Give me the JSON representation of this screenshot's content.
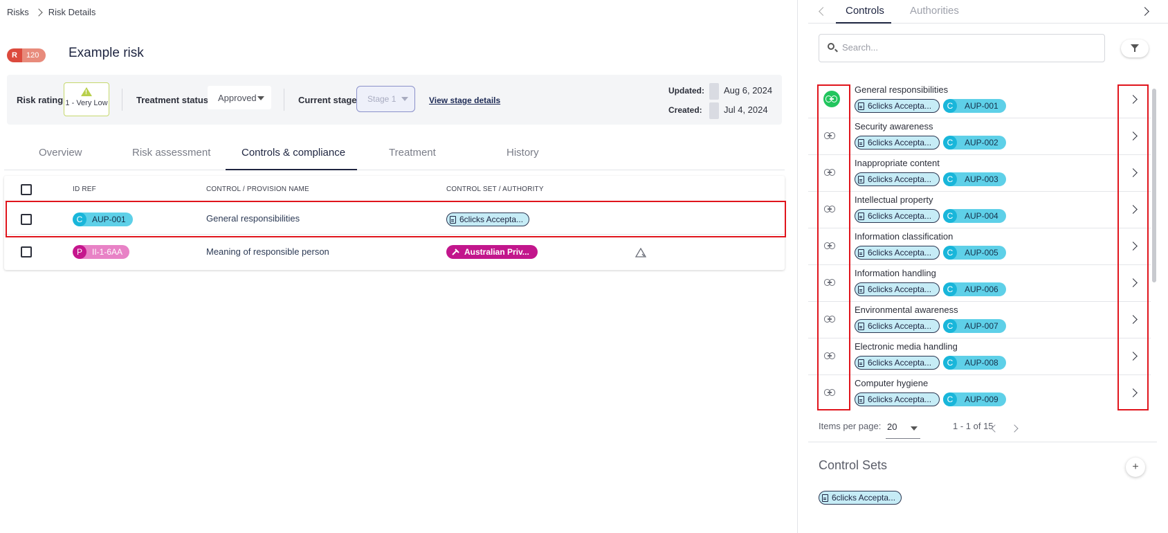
{
  "breadcrumb": {
    "items": [
      "Risks",
      "Risk Details"
    ]
  },
  "risk": {
    "badge_letter": "R",
    "badge_value": "120",
    "title": "Example risk"
  },
  "info": {
    "rating_label": "Risk rating:",
    "rating_value": "1 - Very Low",
    "treatment_label": "Treatment status:",
    "treatment_value": "Approved",
    "stage_label": "Current stage:",
    "stage_value": "Stage 1",
    "stage_link": "View stage details",
    "updated_label": "Updated:",
    "updated_value": "Aug 6, 2024",
    "created_label": "Created:",
    "created_value": "Jul 4, 2024"
  },
  "tabs": [
    "Overview",
    "Risk assessment",
    "Controls & compliance",
    "Treatment",
    "History"
  ],
  "table": {
    "headers": [
      "ID REF",
      "CONTROL / PROVISION NAME",
      "CONTROL SET / AUTHORITY"
    ],
    "rows": [
      {
        "prefix": "C",
        "id": "AUP-001",
        "name": "General responsibilities",
        "set": "6clicks Accepta..."
      },
      {
        "prefix": "P",
        "id": "II-1-6AA",
        "name": "Meaning of responsible person",
        "set": "Australian Priv..."
      }
    ]
  },
  "panel": {
    "tabs": [
      "Controls",
      "Authorities"
    ],
    "search_placeholder": "Search...",
    "controls": [
      {
        "name": "General responsibilities",
        "set": "6clicks Accepta...",
        "prefix": "C",
        "id": "AUP-001"
      },
      {
        "name": "Security awareness",
        "set": "6clicks Accepta...",
        "prefix": "C",
        "id": "AUP-002"
      },
      {
        "name": "Inappropriate content",
        "set": "6clicks Accepta...",
        "prefix": "C",
        "id": "AUP-003"
      },
      {
        "name": "Intellectual property",
        "set": "6clicks Accepta...",
        "prefix": "C",
        "id": "AUP-004"
      },
      {
        "name": "Information classification",
        "set": "6clicks Accepta...",
        "prefix": "C",
        "id": "AUP-005"
      },
      {
        "name": "Information handling",
        "set": "6clicks Accepta...",
        "prefix": "C",
        "id": "AUP-006"
      },
      {
        "name": "Environmental awareness",
        "set": "6clicks Accepta...",
        "prefix": "C",
        "id": "AUP-007"
      },
      {
        "name": "Electronic media handling",
        "set": "6clicks Accepta...",
        "prefix": "C",
        "id": "AUP-008"
      },
      {
        "name": "Computer hygiene",
        "set": "6clicks Accepta...",
        "prefix": "C",
        "id": "AUP-009"
      }
    ],
    "items_per_page_label": "Items per page:",
    "items_per_page": "20",
    "range": "1 - 1 of 15",
    "control_sets_title": "Control Sets",
    "control_sets": [
      "6clicks Accepta..."
    ],
    "add_label": "+"
  },
  "colors": {
    "accent": "#1d2440",
    "highlight": "#e0141c",
    "linked": "#22c55e"
  }
}
